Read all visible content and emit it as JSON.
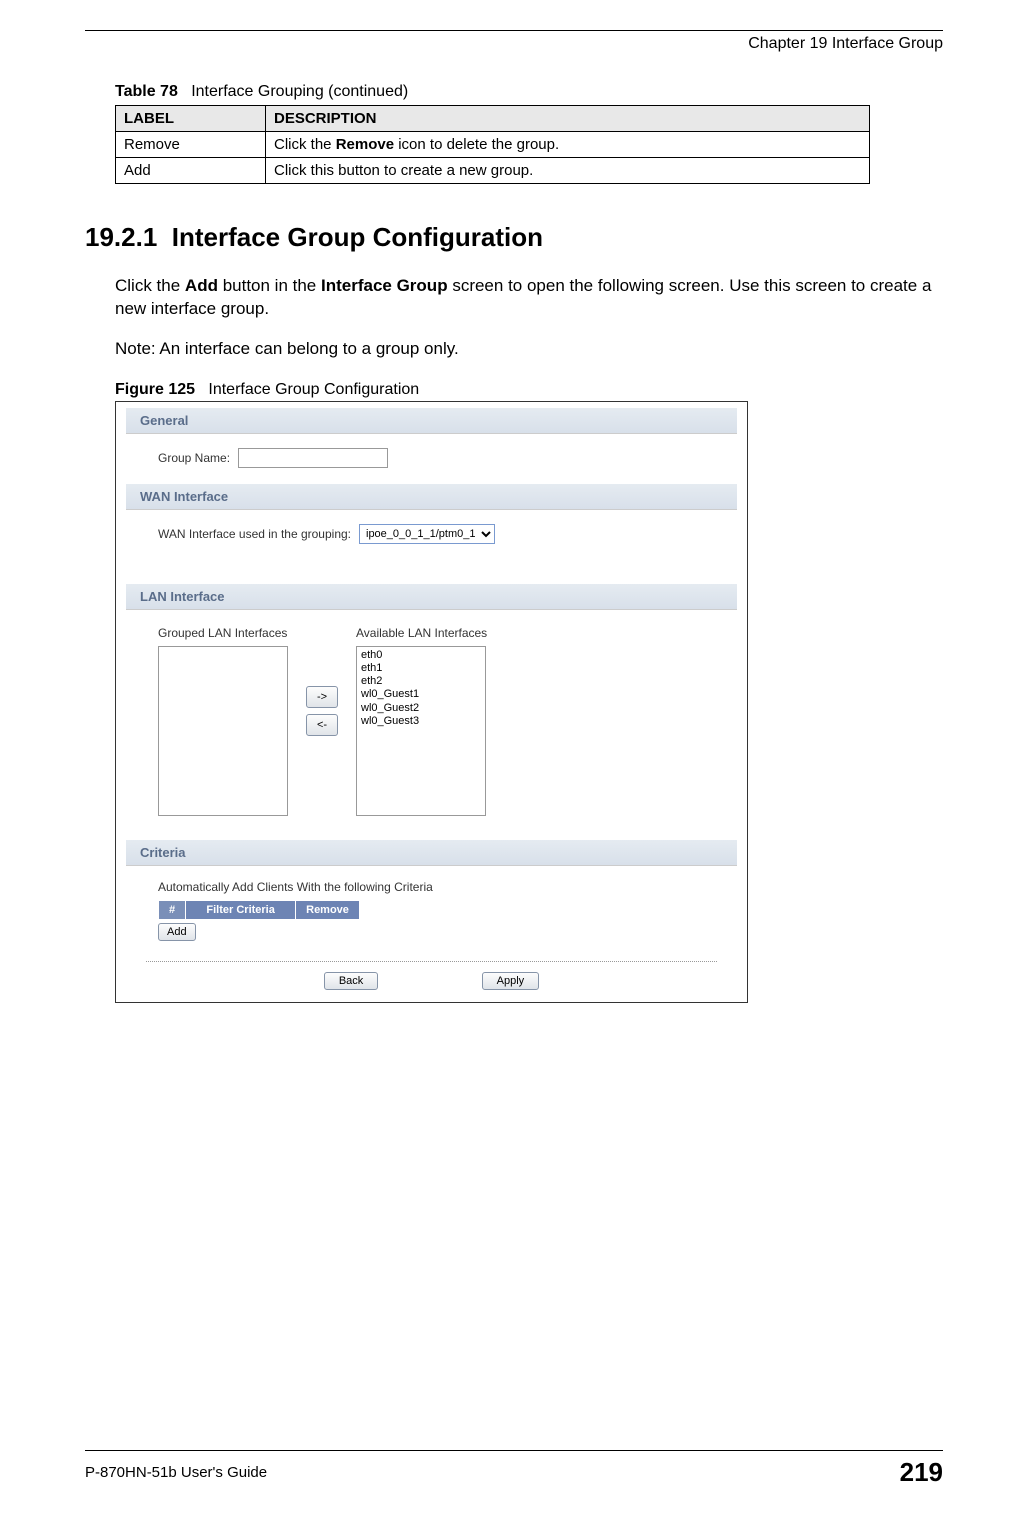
{
  "chapter_header": "Chapter 19 Interface Group",
  "table78": {
    "caption_prefix": "Table 78",
    "caption_text": "Interface Grouping (continued)",
    "header_label": "LABEL",
    "header_desc": "DESCRIPTION",
    "rows": [
      {
        "label": "Remove",
        "desc_pre": "Click the ",
        "desc_bold": "Remove",
        "desc_post": " icon to delete the group."
      },
      {
        "label": "Add",
        "desc_pre": "Click this button to create a new group.",
        "desc_bold": "",
        "desc_post": ""
      }
    ]
  },
  "section": {
    "number": "19.2.1",
    "title": "Interface Group Configuration"
  },
  "paragraph": {
    "p1_a": "Click the ",
    "p1_b1": "Add",
    "p1_c": " button in the ",
    "p1_b2": "Interface Group",
    "p1_d": " screen to open the following screen. Use this screen to create a new interface group."
  },
  "note": "Note: An interface can belong to a group only.",
  "figure": {
    "prefix": "Figure 125",
    "title": "Interface Group Configuration"
  },
  "screenshot": {
    "general": {
      "heading": "General",
      "group_name_label": "Group Name:",
      "group_name_value": ""
    },
    "wan": {
      "heading": "WAN Interface",
      "label": "WAN Interface used in the grouping:",
      "selected": "ipoe_0_0_1_1/ptm0_1"
    },
    "lan": {
      "heading": "LAN Interface",
      "grouped_label": "Grouped LAN Interfaces",
      "available_label": "Available LAN Interfaces",
      "btn_right": "->",
      "btn_left": "<-",
      "available_items": [
        "eth0",
        "eth1",
        "eth2",
        "wl0_Guest1",
        "wl0_Guest2",
        "wl0_Guest3"
      ]
    },
    "criteria": {
      "heading": "Criteria",
      "text": "Automatically Add Clients With the following Criteria",
      "th_num": "#",
      "th_filter": "Filter Criteria",
      "th_remove": "Remove",
      "add_label": "Add"
    },
    "footer": {
      "back": "Back",
      "apply": "Apply"
    }
  },
  "footer": {
    "guide": "P-870HN-51b User's Guide",
    "page": "219"
  }
}
